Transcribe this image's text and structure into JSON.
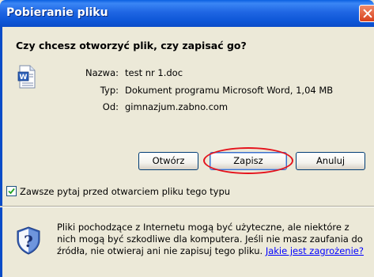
{
  "window": {
    "title": "Pobieranie pliku"
  },
  "dialog": {
    "question": "Czy chcesz otworzyć plik, czy zapisać go?",
    "file": {
      "name_label": "Nazwa:",
      "name_value": "test nr 1.doc",
      "type_label": "Typ:",
      "type_value": "Dokument programu Microsoft Word, 1,04 MB",
      "from_label": "Od:",
      "from_value": "gimnazjum.zabno.com"
    },
    "buttons": {
      "open": "Otwórz",
      "save": "Zapisz",
      "cancel": "Anuluj"
    },
    "always_ask": {
      "label": "Zawsze pytaj przed otwarciem pliku tego typu",
      "checked": true
    },
    "warning": {
      "text": "Pliki pochodzące z Internetu mogą być użyteczne, ale niektóre z nich mogą być szkodliwe dla komputera. Jeśli nie masz zaufania do źródła, nie otwieraj ani nie zapisuj tego pliku.",
      "link": "Jakie jest zagrożenie?"
    }
  },
  "icons": {
    "file": "word-document-icon",
    "security": "security-shield-icon",
    "close": "close-icon"
  },
  "colors": {
    "titlebar": "#0d56d7",
    "close_button": "#d8411c",
    "highlight_ring": "#e5131c",
    "link": "#0000ff"
  }
}
